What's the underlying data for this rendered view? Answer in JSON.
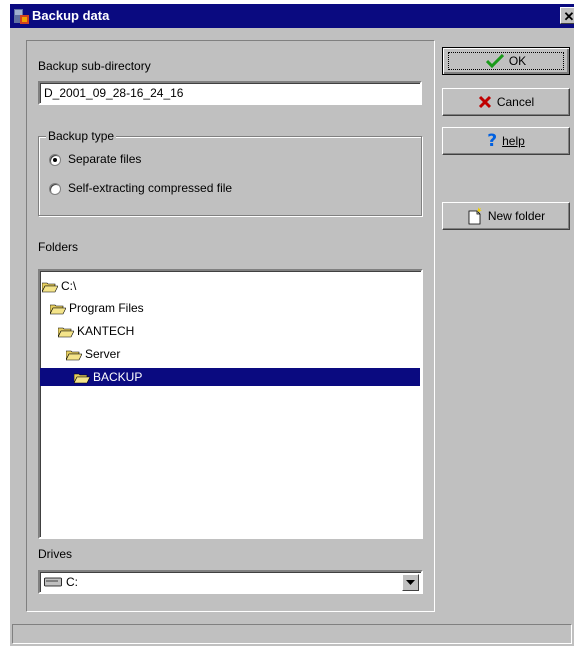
{
  "window": {
    "title": "Backup data",
    "close_glyph": "✕"
  },
  "subdir": {
    "label": "Backup sub-directory",
    "value": "D_2001_09_28-16_24_16"
  },
  "backup_type": {
    "label": "Backup type",
    "options": [
      {
        "label": "Separate files",
        "selected": true
      },
      {
        "label": "Self-extracting compressed file",
        "selected": false
      }
    ]
  },
  "folders": {
    "label": "Folders",
    "items": [
      {
        "label": "C:\\",
        "level": 0,
        "selected": false
      },
      {
        "label": "Program Files",
        "level": 1,
        "selected": false
      },
      {
        "label": "KANTECH",
        "level": 2,
        "selected": false
      },
      {
        "label": "Server",
        "level": 3,
        "selected": false
      },
      {
        "label": "BACKUP",
        "level": 4,
        "selected": true
      }
    ]
  },
  "drives": {
    "label": "Drives",
    "value": "C:"
  },
  "buttons": {
    "ok": {
      "label": "OK",
      "icon": "checkmark-icon",
      "color": "#1a9a1a"
    },
    "cancel": {
      "label": "Cancel",
      "icon": "x-icon",
      "color": "#c00000"
    },
    "help": {
      "label": "help",
      "icon": "question-icon",
      "color": "#0060e0"
    },
    "new_folder": {
      "label": "New folder",
      "icon": "new-folder-icon"
    }
  },
  "colors": {
    "titlebar": "#0a0a80",
    "selection": "#0a0a80",
    "face": "#c0c0c0",
    "folder": "#e8d060"
  }
}
